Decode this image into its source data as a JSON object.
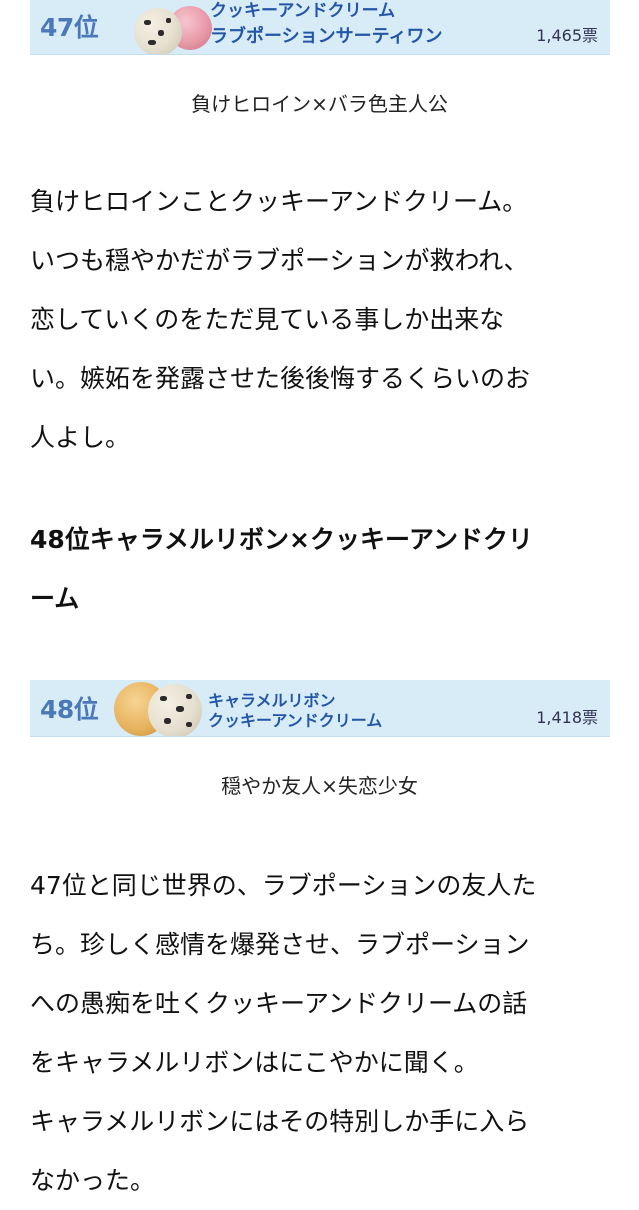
{
  "entry47": {
    "banner": {
      "rank": "47位",
      "flavor_line1": "クッキーアンドクリーム",
      "flavor_line2": "ラブポーションサーティワン",
      "votes": "1,465票"
    },
    "caption": "負けヒロイン×バラ色主人公",
    "paragraph_lines": [
      "負けヒロインことクッキーアンドクリーム。",
      "いつも穏やかだがラブポーションが救われ、",
      "恋していくのをただ見ている事しか出来な",
      "い。嫉妬を発露させた後後悔するくらいのお",
      "人よし。"
    ]
  },
  "entry48": {
    "heading_lines": [
      "48位キャラメルリボン×クッキーアンドクリ",
      "ーム"
    ],
    "banner": {
      "rank": "48位",
      "flavor_line1": "キャラメルリボン",
      "flavor_line2": "クッキーアンドクリーム",
      "votes": "1,418票"
    },
    "caption": "穏やか友人×失恋少女",
    "paragraph_lines": [
      "47位と同じ世界の、ラブポーションの友人た",
      "ち。珍しく感情を爆発させ、ラブポーション",
      "への愚痴を吐くクッキーアンドクリームの話",
      "をキャラメルリボンはにこやかに聞く。",
      "キャラメルリボンにはその特別しか手に入ら",
      "なかった。"
    ]
  },
  "colors": {
    "banner_background": "#d8ecf8",
    "rank_text": "#4a78b8",
    "flavor_text": "#2456a8",
    "body_text": "#111111"
  }
}
